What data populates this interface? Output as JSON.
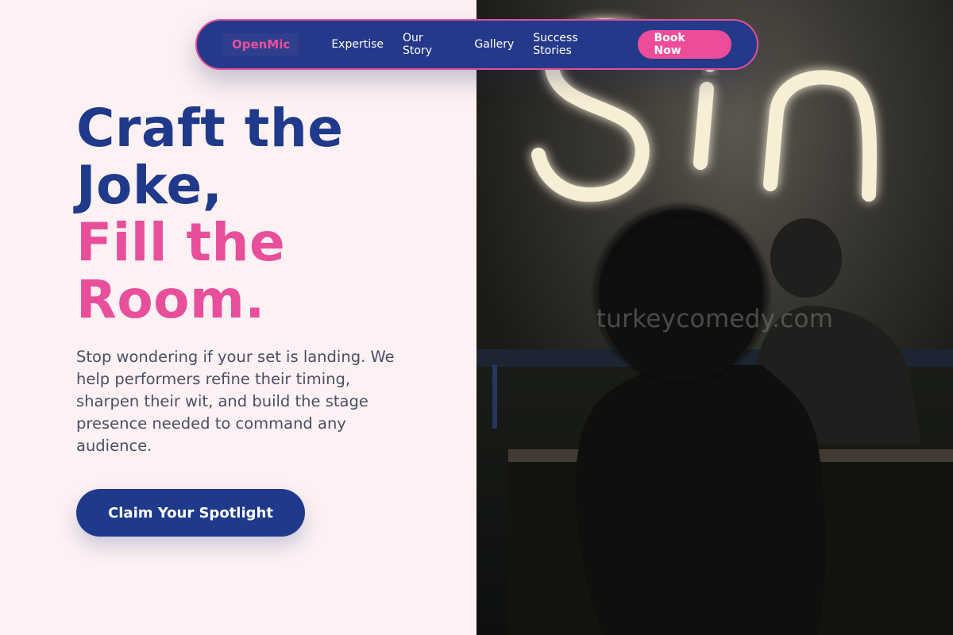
{
  "nav": {
    "logo": "OpenMic",
    "links": [
      "Expertise",
      "Our Story",
      "Gallery",
      "Success Stories"
    ],
    "cta": "Book Now"
  },
  "hero": {
    "headline_lines": [
      "Craft the",
      "Joke,",
      "Fill the",
      "Room."
    ],
    "description": "Stop wondering if your set is landing. We help performers refine their timing, sharpen their wit, and build the stage presence needed to command any audience.",
    "cta": "Claim Your Spotlight"
  },
  "photo": {
    "description": "Silhouetted audience member facing a glowing neon sign in a dark comedy venue",
    "neon_text": "Sin",
    "watermark": "turkeycomedy.com"
  },
  "colors": {
    "navy": "#1f3a8a",
    "pink": "#e84f9b",
    "background": "#fdf1f3",
    "nav_bg": "#25398a"
  }
}
